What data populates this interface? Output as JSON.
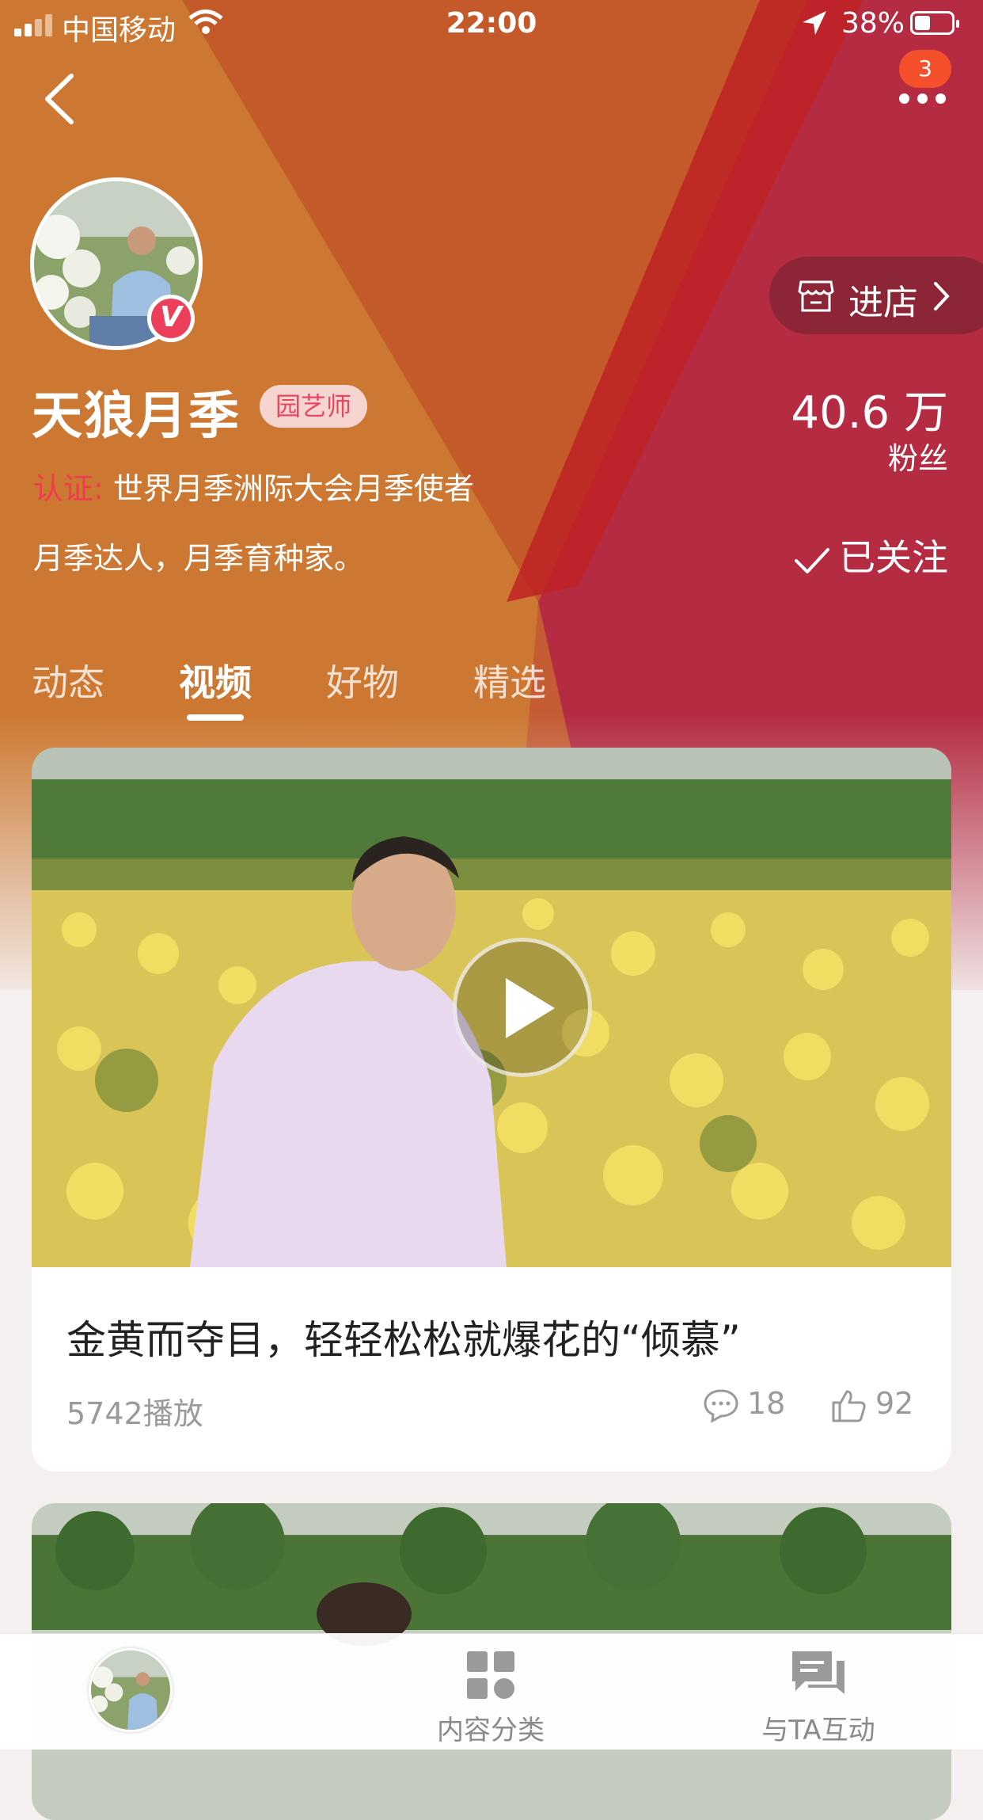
{
  "status_bar": {
    "carrier": "中国移动",
    "time": "22:00",
    "battery": "38%"
  },
  "nav": {
    "notification_count": "3"
  },
  "profile": {
    "name": "天狼月季",
    "tag": "园艺师",
    "fans_count": "40.6 万",
    "fans_label": "粉丝",
    "shop_button": "进店",
    "cert_label": "认证:",
    "cert_text": "世界月季洲际大会月季使者",
    "bio": "月季达人，月季育种家。",
    "follow_state": "已关注"
  },
  "tabs": [
    "动态",
    "视频",
    "好物",
    "精选"
  ],
  "active_tab": "视频",
  "videos": [
    {
      "title": "金黄而夺目，轻轻松松就爆花的“倾慕”",
      "plays": "5742播放",
      "comments": "18",
      "likes": "92"
    }
  ],
  "bottom_bar": {
    "category": "内容分类",
    "interact": "与TA互动"
  },
  "colors": {
    "orange": "#cf7a34",
    "red": "#b52a3f",
    "accent_red": "#ef3c4c",
    "badge": "#f3502b"
  }
}
